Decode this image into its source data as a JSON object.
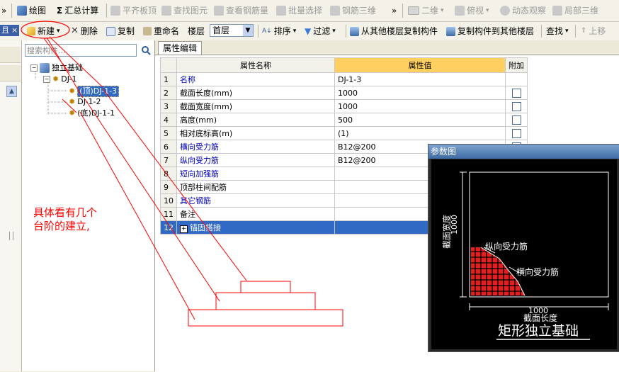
{
  "toolbar1": {
    "items": [
      {
        "label": "»",
        "icon": "overflow-chevron-icon"
      },
      {
        "label": "绘图",
        "icon": "draw-icon"
      },
      {
        "label": "汇总计算",
        "icon": "sigma-icon"
      },
      {
        "label": "平齐板顶",
        "icon": "align-slab-icon"
      },
      {
        "label": "查找图元",
        "icon": "find-element-icon"
      },
      {
        "label": "查看钢筋量",
        "icon": "rebar-quantity-icon"
      },
      {
        "label": "批量选择",
        "icon": "batch-select-icon"
      },
      {
        "label": "钢筋三维",
        "icon": "rebar-3d-icon"
      },
      {
        "label": "»",
        "icon": "overflow-chevron-icon"
      },
      {
        "label": "二维",
        "icon": "view-2d-icon"
      },
      {
        "label": "俯视",
        "icon": "top-view-icon"
      },
      {
        "label": "动态观察",
        "icon": "orbit-icon"
      },
      {
        "label": "局部三维",
        "icon": "local-3d-icon"
      }
    ]
  },
  "toolbar2": {
    "pin_label": "且",
    "close_label": "×",
    "new_label": "新建",
    "delete_label": "删除",
    "copy_label": "复制",
    "rename_label": "重命名",
    "floor_label": "楼层",
    "floor_value": "首层",
    "sort_label": "排序",
    "filter_label": "过滤",
    "copy_from_label": "从其他楼层复制构件",
    "copy_to_label": "复制构件到其他楼层",
    "find_label": "查找",
    "up_label": "上移"
  },
  "tree": {
    "search_placeholder": "搜索构件...",
    "root": "独立基础",
    "group": "DJ-1",
    "children": [
      "(顶)DJ-1-3",
      "DJ-1-2",
      "(底)DJ-1-1"
    ],
    "selected_index": 0
  },
  "tab": {
    "label": "属性编辑"
  },
  "grid": {
    "headers": [
      "",
      "属性名称",
      "属性值",
      "附加"
    ],
    "rows": [
      {
        "num": "1",
        "name": "名称",
        "value": "DJ-1-3",
        "blue": true,
        "checkbox": false
      },
      {
        "num": "2",
        "name": "截面长度(mm)",
        "value": "1000",
        "blue": false,
        "checkbox": true
      },
      {
        "num": "3",
        "name": "截面宽度(mm)",
        "value": "1000",
        "blue": false,
        "checkbox": true
      },
      {
        "num": "4",
        "name": "高度(mm)",
        "value": "500",
        "blue": false,
        "checkbox": true
      },
      {
        "num": "5",
        "name": "相对底标高(m)",
        "value": "(1)",
        "blue": false,
        "checkbox": true
      },
      {
        "num": "6",
        "name": "横向受力筋",
        "value": "B12@200",
        "blue": true,
        "checkbox": true
      },
      {
        "num": "7",
        "name": "纵向受力筋",
        "value": "B12@200",
        "blue": true,
        "checkbox": true
      },
      {
        "num": "8",
        "name": "短向加强筋",
        "value": "",
        "blue": true,
        "checkbox": false
      },
      {
        "num": "9",
        "name": "顶部柱间配筋",
        "value": "",
        "blue": false,
        "checkbox": false
      },
      {
        "num": "10",
        "name": "其它钢筋",
        "value": "",
        "blue": true,
        "checkbox": false
      },
      {
        "num": "11",
        "name": "备注",
        "value": "",
        "blue": false,
        "checkbox": false
      },
      {
        "num": "12",
        "name": "锚固搭接",
        "value": "",
        "blue": false,
        "checkbox": false,
        "expand": "+",
        "selected": true
      }
    ]
  },
  "annotation": {
    "line1": "具体看有几个",
    "line2": "台阶的建立,",
    "color": "#ff0000"
  },
  "param_panel": {
    "title": "参数图",
    "width_dim": "1000",
    "width_label": "截面宽度",
    "length_dim": "1000",
    "length_label": "截面长度",
    "long_bar_label": "纵向受力筋",
    "trans_bar_label": "横向受力筋",
    "caption": "矩形独立基础"
  },
  "colors": {
    "selection": "#316ac5",
    "header_highlight": "#ffd060",
    "annotation_red": "#ff0000",
    "rebar_red": "#e02020"
  }
}
